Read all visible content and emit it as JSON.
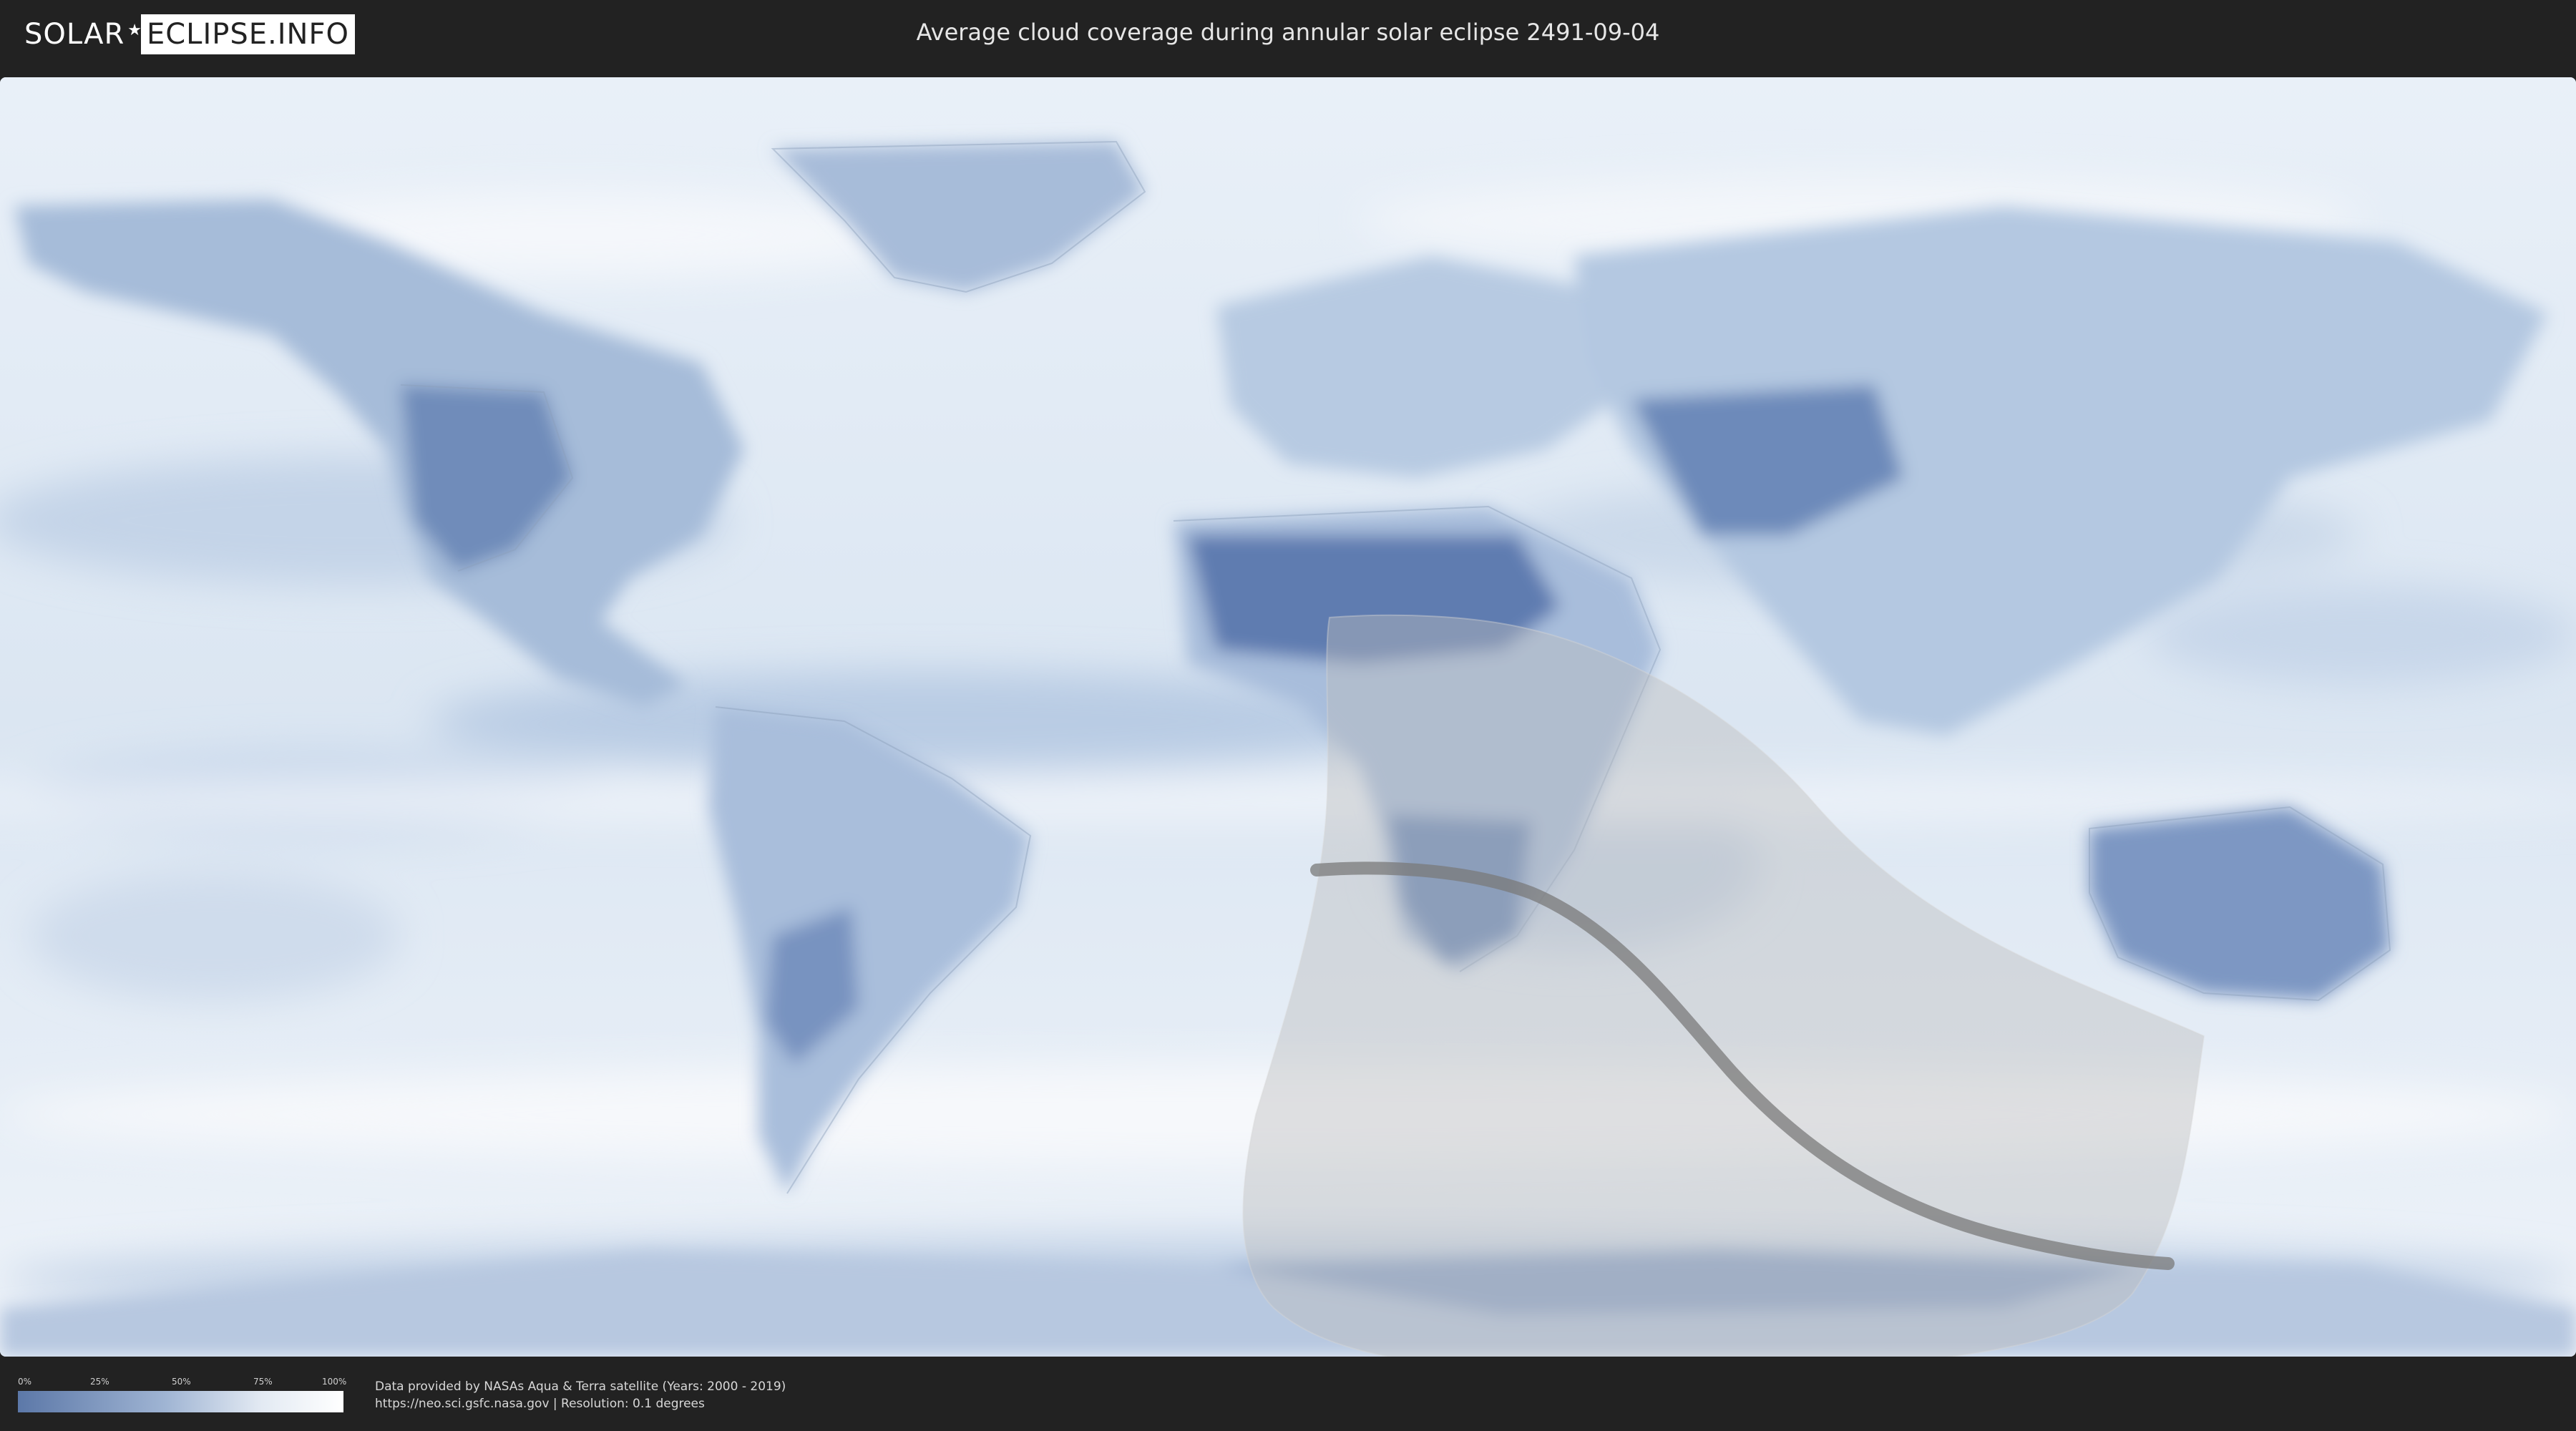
{
  "header": {
    "logo_left": "SOLAR",
    "logo_right": "ECLIPSE.INFO",
    "title": "Average cloud coverage during annular solar eclipse 2491-09-04"
  },
  "legend": {
    "ticks": [
      "0%",
      "25%",
      "50%",
      "75%",
      "100%"
    ],
    "colors": {
      "low": "#5c78a8",
      "high": "#ffffff"
    }
  },
  "credits": {
    "line1": "Data provided by NASAs Aqua & Terra satellite (Years: 2000 - 2019)",
    "line2": "https://neo.sci.gsfc.nasa.gov | Resolution: 0.1 degrees"
  },
  "colors": {
    "background": "#222222",
    "ocean_cloud": "#dfe9f4",
    "clear_land": "#6f8cba",
    "eclipse_zone": "#bdbdbd",
    "central_line": "#7a7a7a"
  }
}
